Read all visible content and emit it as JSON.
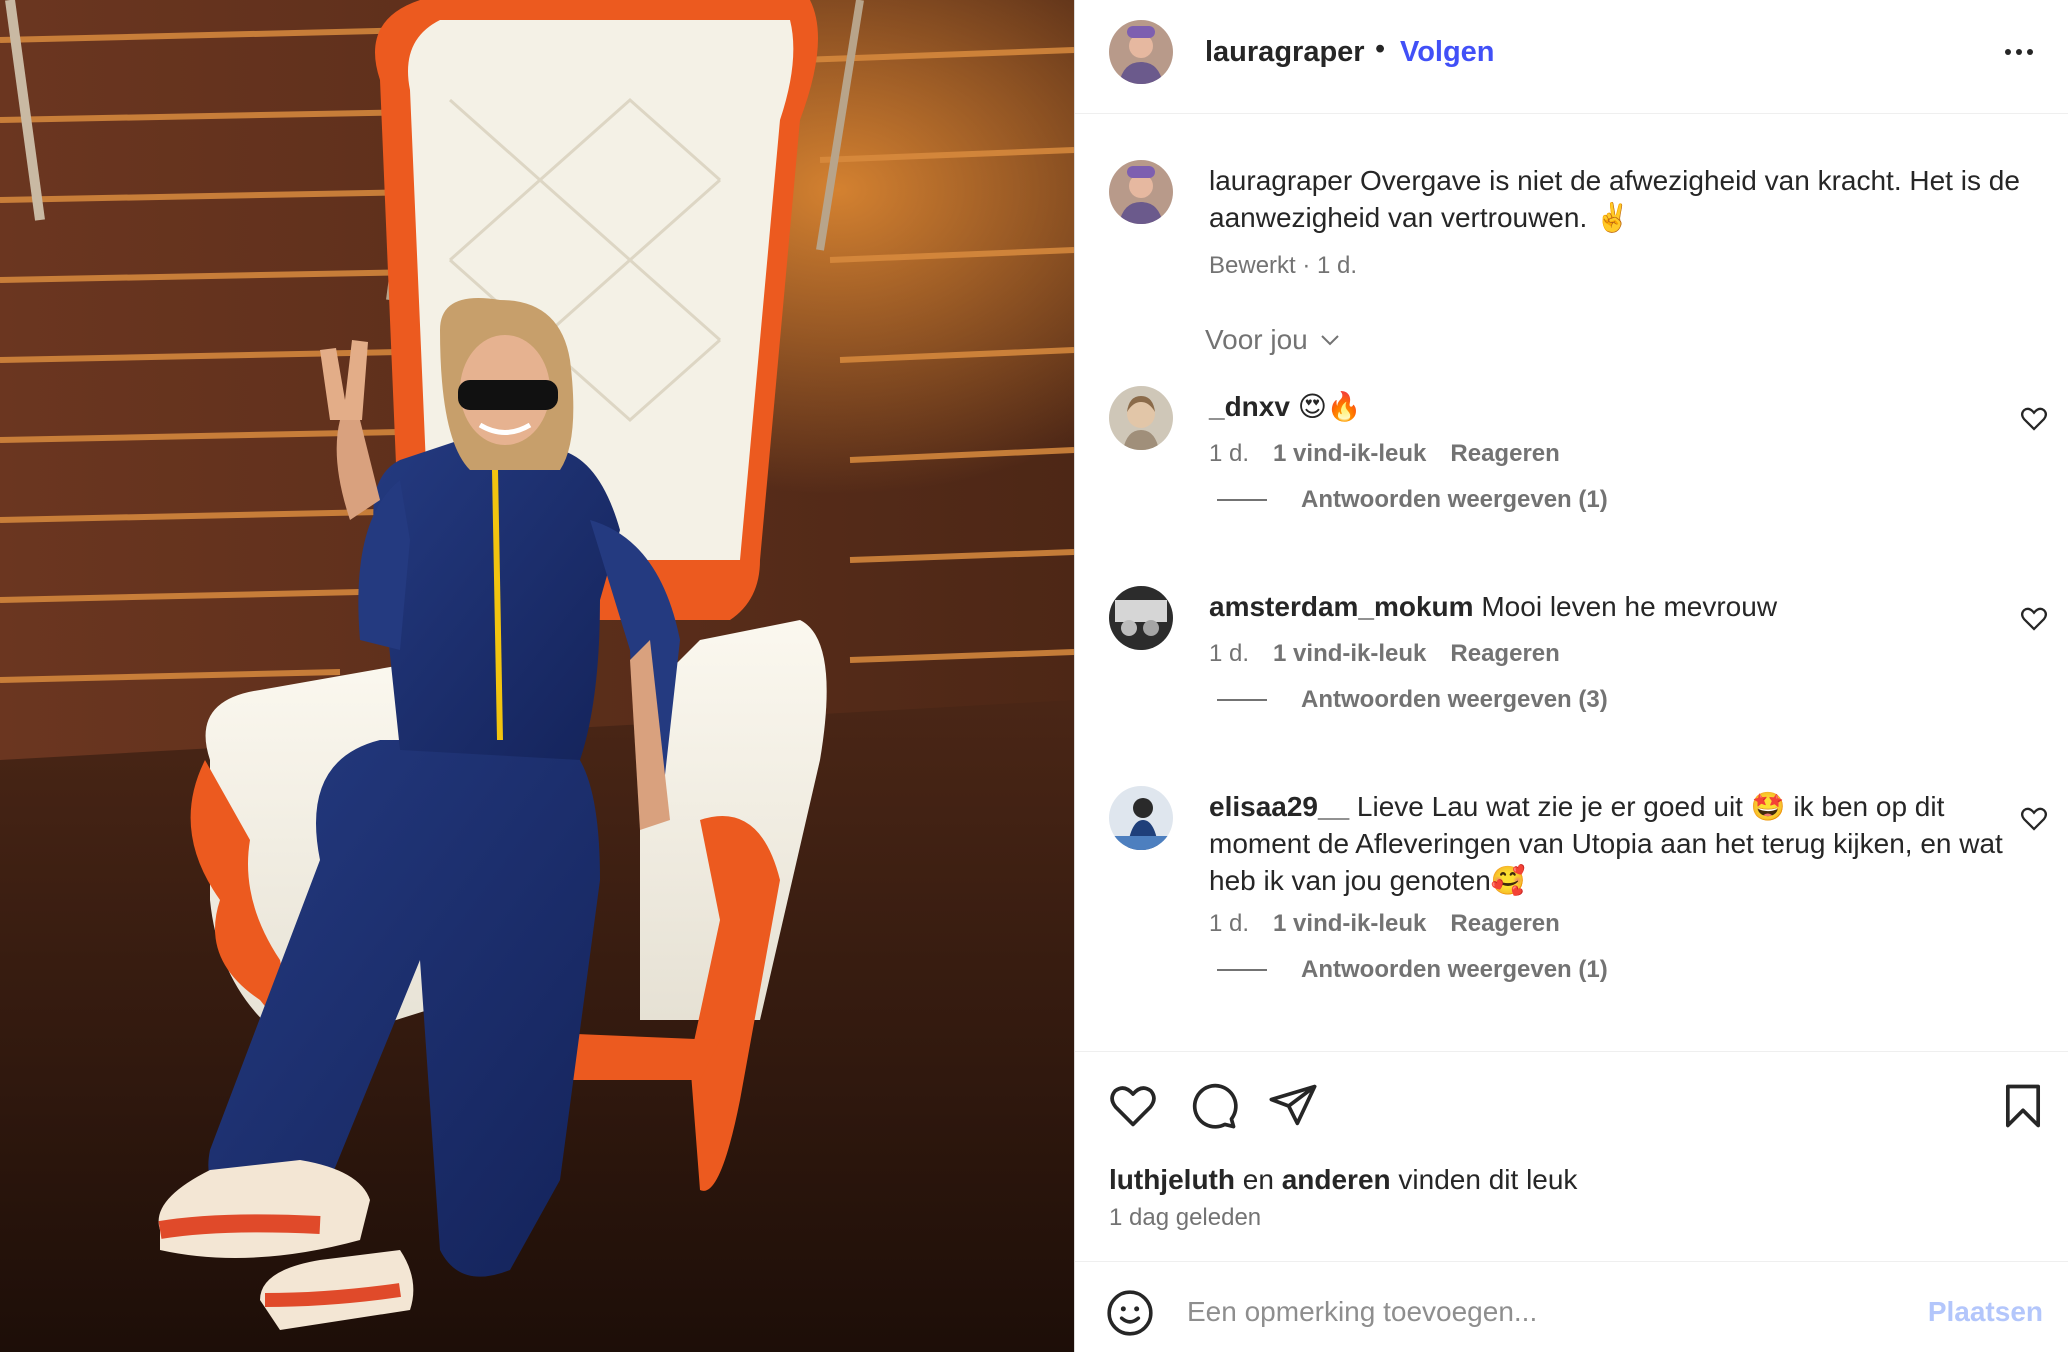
{
  "post": {
    "username": "lauragraper",
    "separator": "•",
    "follow_label": "Volgen",
    "caption_user": "lauragraper",
    "caption_text": "Overgave is niet de afwezigheid van kracht. Het is de aanwezigheid van vertrouwen. ✌️",
    "caption_meta": "Bewerkt · 1 d."
  },
  "sort": {
    "label": "Voor jou"
  },
  "comments": [
    {
      "user": "_dnxv",
      "text": "😍🔥",
      "age": "1 d.",
      "likes": "1 vind-ik-leuk",
      "reply": "Reageren",
      "view_replies": "Antwoorden weergeven (1)"
    },
    {
      "user": "amsterdam_mokum",
      "text": "Mooi leven he mevrouw",
      "age": "1 d.",
      "likes": "1 vind-ik-leuk",
      "reply": "Reageren",
      "view_replies": "Antwoorden weergeven (3)"
    },
    {
      "user": "elisaa29__",
      "text": "Lieve Lau wat zie je er goed uit 🤩 ik ben op dit moment de Afleveringen van Utopia aan het terug kijken, en wat heb ik van jou genoten🥰",
      "age": "1 d.",
      "likes": "1 vind-ik-leuk",
      "reply": "Reageren",
      "view_replies": "Antwoorden weergeven (1)"
    }
  ],
  "likes_line": {
    "user": "luthjeluth",
    "connector": "en",
    "others": "anderen",
    "suffix": "vinden dit leuk"
  },
  "timestamp": "1 dag geleden",
  "composer": {
    "placeholder": "Een opmerking toevoegen...",
    "post_label": "Plaatsen"
  },
  "icons": {
    "more": "more-horizontal-icon",
    "chevron": "chevron-down-icon",
    "comment_like": "heart-outline-icon",
    "like": "heart-icon",
    "comment": "comment-bubble-icon",
    "share": "paper-plane-icon",
    "save": "bookmark-icon",
    "emoji": "smiley-icon"
  },
  "colors": {
    "accent": "#4150f7",
    "text": "#262626",
    "muted": "#737373",
    "post_disabled": "#b3c6fb"
  }
}
